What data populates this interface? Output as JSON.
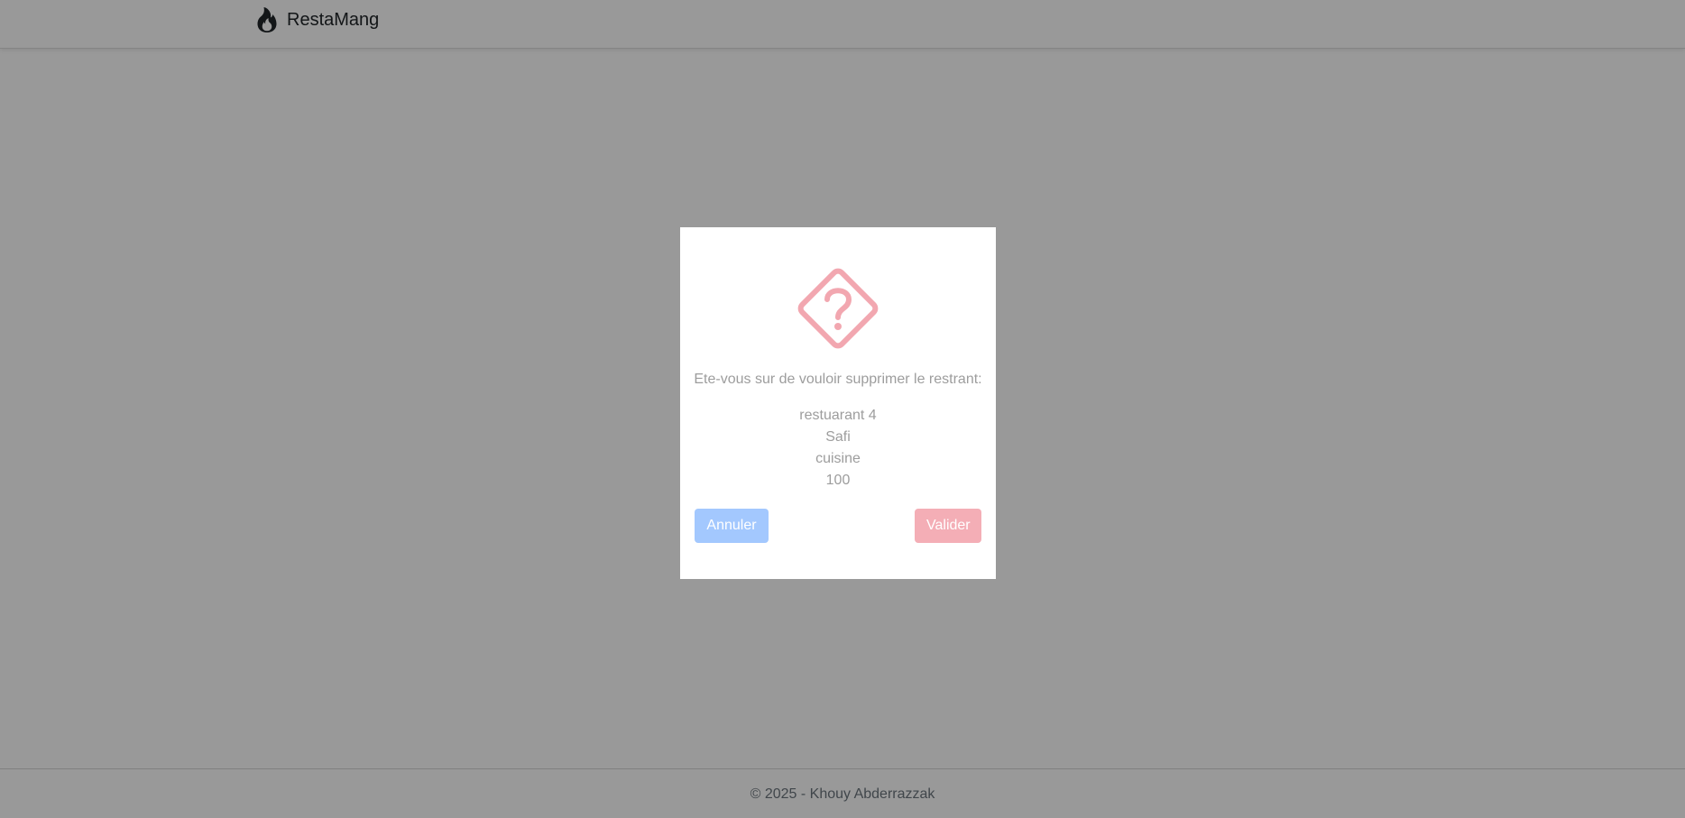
{
  "navbar": {
    "brand_name": "RestaMang",
    "brand_icon": "fire-icon"
  },
  "footer": {
    "text": "© 2025 - Khouy Abderrazzak"
  },
  "modal": {
    "icon": "question-diamond-icon",
    "icon_color": "#f2a7b0",
    "question": "Ete-vous sur de vouloir supprimer le restrant:",
    "details": {
      "name": "restuarant 4",
      "city": "Safi",
      "category": "cuisine",
      "value": "100"
    },
    "cancel_label": "Annuler",
    "confirm_label": "Valider",
    "cancel_color": "#a3c8fe",
    "confirm_color": "#f4aeb6"
  }
}
